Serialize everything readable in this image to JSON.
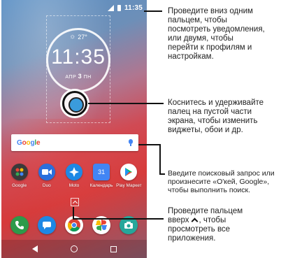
{
  "status_bar": {
    "time": "11:35"
  },
  "clock_widget": {
    "temperature": "27°",
    "time": "11:35",
    "date_month": "АПР",
    "date_day": "3",
    "date_weekday": "ПН"
  },
  "search": {
    "logo": "Google"
  },
  "apps": [
    {
      "label": "Google",
      "icon": "google-folder-icon",
      "color": "#3a3a3a"
    },
    {
      "label": "Duo",
      "icon": "duo-icon",
      "color": "#2a6fdc"
    },
    {
      "label": "Moto",
      "icon": "moto-icon",
      "color": "#1e88e5"
    },
    {
      "label": "Календарь",
      "icon": "calendar-icon",
      "color": "#4285f4"
    },
    {
      "label": "Play Маркет",
      "icon": "play-store-icon",
      "color": "#ffffff"
    }
  ],
  "dock": [
    {
      "icon": "phone-icon",
      "color": "#2e9a4a"
    },
    {
      "icon": "messages-icon",
      "color": "#1e88e5"
    },
    {
      "icon": "chrome-icon",
      "color": "#ffffff"
    },
    {
      "icon": "photos-icon",
      "color": "#ffffff"
    },
    {
      "icon": "camera-icon",
      "color": "#26a69a"
    }
  ],
  "annotations": {
    "swipe_down": "Проведите вниз одним пальцем, чтобы посмотреть уведомления, или двумя, чтобы перейти к профилям и настройкам.",
    "touch_hold": "Коснитесь и удерживайте палец на пустой части экрана, чтобы изменить виджеты, обои и др.",
    "search": "Введите поисковый запрос или произнесите «О'кей, Google», чтобы выполнить поиск.",
    "swipe_up_before": "Проведите пальцем вверх",
    "swipe_up_after": ", чтобы просмотреть все приложения."
  }
}
